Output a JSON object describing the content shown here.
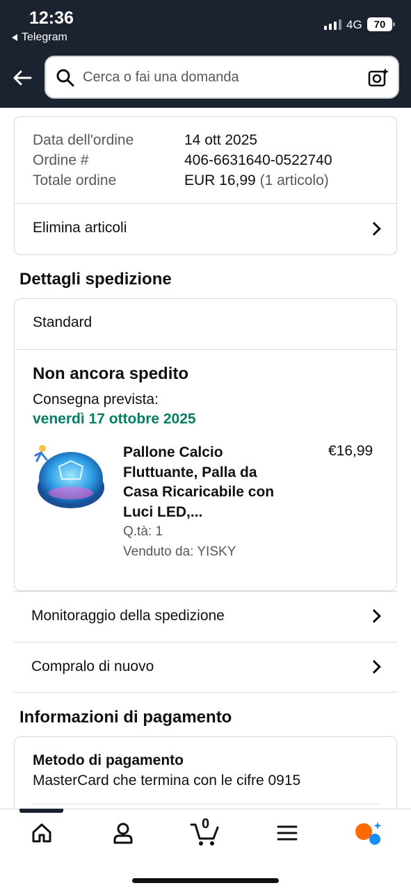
{
  "status_bar": {
    "time": "12:36",
    "back_app": "Telegram",
    "network": "4G",
    "battery": "70"
  },
  "search": {
    "placeholder": "Cerca o fai una domanda"
  },
  "order_summary": {
    "date_label": "Data dell'ordine",
    "date_value": "14 ott 2025",
    "order_label": "Ordine #",
    "order_value": "406-6631640-0522740",
    "total_label": "Totale ordine",
    "total_value": "EUR 16,99",
    "total_count": "(1 articolo)",
    "delete_items": "Elimina articoli"
  },
  "shipping": {
    "section_title": "Dettagli spedizione",
    "method": "Standard",
    "status": "Non ancora spedito",
    "delivery_label": "Consegna prevista:",
    "delivery_date": "venerdì 17 ottobre 2025",
    "delivery_color": "#067d62",
    "item": {
      "title_line1": "Pallone Calcio",
      "title_line2": "Fluttuante, Palla da",
      "title_line3": "Casa Ricaricabile con",
      "title_line4": "Luci LED,...",
      "qty": "Q.tà: 1",
      "seller": "Venduto da: YISKY",
      "price": "€16,99"
    },
    "tracking": "Monitoraggio della spedizione",
    "buy_again": "Compralo di nuovo"
  },
  "payment": {
    "section_title": "Informazioni di pagamento",
    "method_title": "Metodo di pagamento",
    "method_value": "MasterCard che termina con le cifre 0915"
  },
  "bottom_nav": {
    "items": [
      "home-icon",
      "account-icon",
      "cart-icon",
      "menu-icon",
      "rufus-icon"
    ],
    "cart_count": "0"
  }
}
